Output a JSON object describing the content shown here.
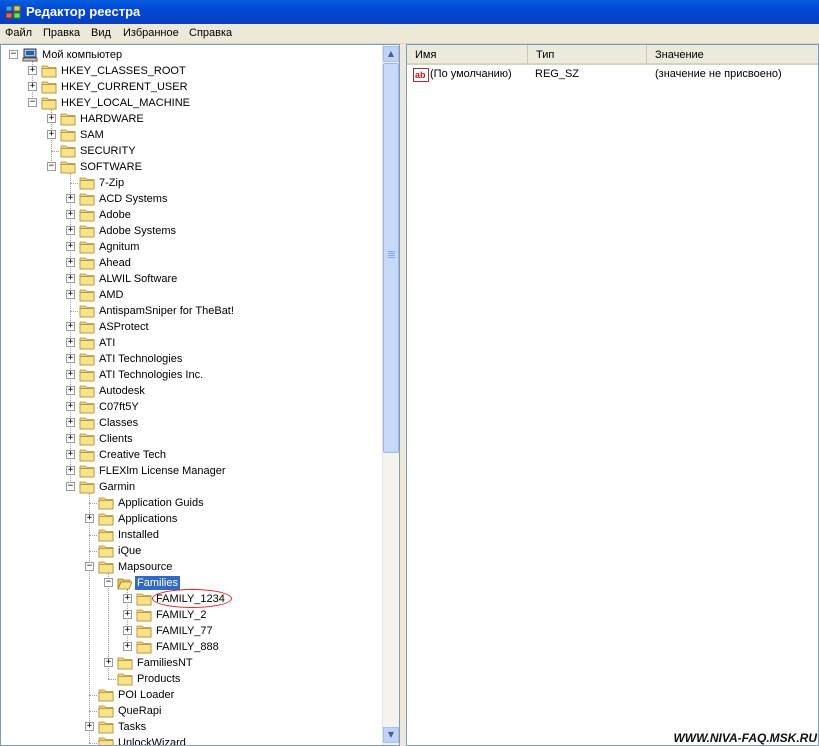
{
  "window": {
    "title": "Редактор реестра"
  },
  "menu": [
    "Файл",
    "Правка",
    "Вид",
    "Избранное",
    "Справка"
  ],
  "tree": [
    {
      "label": "Мой компьютер",
      "level": 0,
      "toggle": "-",
      "icon": "computer-icon"
    },
    {
      "label": "HKEY_CLASSES_ROOT",
      "level": 1,
      "toggle": "+"
    },
    {
      "label": "HKEY_CURRENT_USER",
      "level": 1,
      "toggle": "+"
    },
    {
      "label": "HKEY_LOCAL_MACHINE",
      "level": 1,
      "toggle": "-"
    },
    {
      "label": "HARDWARE",
      "level": 2,
      "toggle": "+"
    },
    {
      "label": "SAM",
      "level": 2,
      "toggle": "+"
    },
    {
      "label": "SECURITY",
      "level": 2,
      "toggle": ""
    },
    {
      "label": "SOFTWARE",
      "level": 2,
      "toggle": "-"
    },
    {
      "label": "7-Zip",
      "level": 3,
      "toggle": ""
    },
    {
      "label": "ACD Systems",
      "level": 3,
      "toggle": "+"
    },
    {
      "label": "Adobe",
      "level": 3,
      "toggle": "+"
    },
    {
      "label": "Adobe Systems",
      "level": 3,
      "toggle": "+"
    },
    {
      "label": "Agnitum",
      "level": 3,
      "toggle": "+"
    },
    {
      "label": "Ahead",
      "level": 3,
      "toggle": "+"
    },
    {
      "label": "ALWIL Software",
      "level": 3,
      "toggle": "+"
    },
    {
      "label": "AMD",
      "level": 3,
      "toggle": "+"
    },
    {
      "label": "AntispamSniper for TheBat!",
      "level": 3,
      "toggle": ""
    },
    {
      "label": "ASProtect",
      "level": 3,
      "toggle": "+"
    },
    {
      "label": "ATI",
      "level": 3,
      "toggle": "+"
    },
    {
      "label": "ATI Technologies",
      "level": 3,
      "toggle": "+"
    },
    {
      "label": "ATI Technologies Inc.",
      "level": 3,
      "toggle": "+"
    },
    {
      "label": "Autodesk",
      "level": 3,
      "toggle": "+"
    },
    {
      "label": "C07ft5Y",
      "level": 3,
      "toggle": "+"
    },
    {
      "label": "Classes",
      "level": 3,
      "toggle": "+"
    },
    {
      "label": "Clients",
      "level": 3,
      "toggle": "+"
    },
    {
      "label": "Creative Tech",
      "level": 3,
      "toggle": "+"
    },
    {
      "label": "FLEXlm License Manager",
      "level": 3,
      "toggle": "+"
    },
    {
      "label": "Garmin",
      "level": 3,
      "toggle": "-"
    },
    {
      "label": "Application Guids",
      "level": 4,
      "toggle": ""
    },
    {
      "label": "Applications",
      "level": 4,
      "toggle": "+"
    },
    {
      "label": "Installed",
      "level": 4,
      "toggle": ""
    },
    {
      "label": "iQue",
      "level": 4,
      "toggle": ""
    },
    {
      "label": "Mapsource",
      "level": 4,
      "toggle": "-"
    },
    {
      "label": "Families",
      "level": 5,
      "toggle": "-",
      "selected": true,
      "open": true
    },
    {
      "label": "FAMILY_1234",
      "level": 6,
      "toggle": "+"
    },
    {
      "label": "FAMILY_2",
      "level": 6,
      "toggle": "+"
    },
    {
      "label": "FAMILY_77",
      "level": 6,
      "toggle": "+"
    },
    {
      "label": "FAMILY_888",
      "level": 6,
      "toggle": "+"
    },
    {
      "label": "FamiliesNT",
      "level": 5,
      "toggle": "+"
    },
    {
      "label": "Products",
      "level": 5,
      "toggle": ""
    },
    {
      "label": "POI Loader",
      "level": 4,
      "toggle": ""
    },
    {
      "label": "QueRapi",
      "level": 4,
      "toggle": ""
    },
    {
      "label": "Tasks",
      "level": 4,
      "toggle": "+"
    },
    {
      "label": "UnlockWizard",
      "level": 4,
      "toggle": ""
    }
  ],
  "list": {
    "columns": [
      "Имя",
      "Тип",
      "Значение"
    ],
    "rows": [
      {
        "name": "(По умолчанию)",
        "type": "REG_SZ",
        "value": "(значение не присвоено)"
      }
    ]
  },
  "watermark": "WWW.NIVA-FAQ.MSK.RU",
  "colors": {
    "selection": "#316ac5",
    "annotation": "#e02020",
    "folder": "#f2d56b"
  }
}
